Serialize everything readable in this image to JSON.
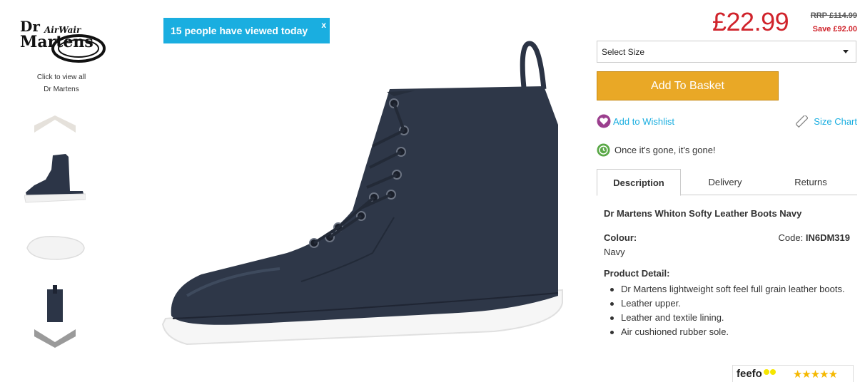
{
  "brand": {
    "logo_text_top": "Dr",
    "logo_text_mid": "AirWair",
    "logo_text_bottom": "Martens",
    "view_all_line1": "Click to view all",
    "view_all_line2": "Dr Martens"
  },
  "viewed_banner": {
    "text": "15 people have viewed today",
    "close_label": "x"
  },
  "price": {
    "current": "£22.99",
    "rrp": "RRP £114.99",
    "save": "Save £92.00",
    "price_color": "#d0232b"
  },
  "size_select": {
    "selected": "Select Size"
  },
  "actions": {
    "add_to_basket": "Add To Basket",
    "add_to_wishlist": "Add to Wishlist",
    "size_chart": "Size Chart",
    "button_color": "#e9a826",
    "link_color": "#1aaee0"
  },
  "stock_note": "Once it's gone, it's gone!",
  "tabs": [
    {
      "label": "Description",
      "active": true
    },
    {
      "label": "Delivery",
      "active": false
    },
    {
      "label": "Returns",
      "active": false
    }
  ],
  "description": {
    "title": "Dr Martens Whiton Softy Leather Boots Navy",
    "colour_label": "Colour:",
    "colour_value": "Navy",
    "code_label": "Code:",
    "code_value": "IN6DM319",
    "detail_label": "Product Detail:",
    "details": [
      "Dr Martens lightweight soft feel full grain leather boots.",
      "Leather upper.",
      "Leather and textile lining.",
      "Air cushioned rubber sole."
    ]
  },
  "feefo": {
    "label": "feefo",
    "stars": "★★★★★"
  }
}
